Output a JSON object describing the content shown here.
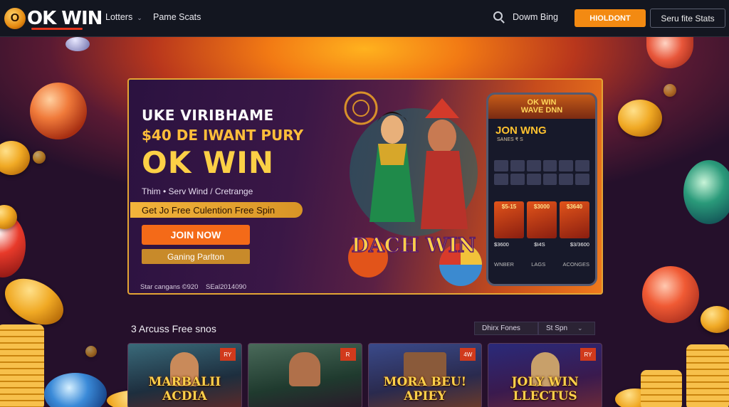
{
  "nav": {
    "logo_text": "OK WIN",
    "links": [
      "Lotters",
      "Pame Scats"
    ],
    "search_label": "Dowm Bing",
    "hold_button": "HIOLDONT",
    "stats_button": "Seru fite Stats"
  },
  "hero": {
    "title_line1": "UKE VIRIBHAME",
    "title_line2": "$40 DE IWANT PURY",
    "title_line3": "OK WIN",
    "subtitle": "Thim • Serv Wind / Cretrange",
    "promo": "Get Jo Free Culention Free Spin",
    "join_button": "JOIN NOW",
    "gaming_button": "Ganing Parlton",
    "footer_left": "Star cangans ©920",
    "footer_right": "SEal2014090",
    "art_caption": "DACH WIN",
    "phone": {
      "header": "OK WIN\nWAVE DNN",
      "title": "JON WNG",
      "subtitle": "SANES ₹ S",
      "tiles": [
        "$5-15",
        "$3000",
        "$3640"
      ],
      "values": [
        "$3600",
        "$I4S",
        "$3/3600"
      ],
      "bottom": [
        "WNBER",
        "LAGS",
        "ACONGES"
      ]
    }
  },
  "games": {
    "title": "3 Arcuss Free snos",
    "filter1": "Dhirx Fones",
    "filter2": "St Spn",
    "cards": [
      {
        "title": "MARBALII ACDIA",
        "badge": "RY"
      },
      {
        "title": "",
        "badge": "R"
      },
      {
        "title": "MORA BEU! APIEY",
        "badge": "4W"
      },
      {
        "title": "JOLY WIN LLECTUS",
        "badge": "RY"
      }
    ]
  },
  "colors": {
    "nav_bg": "#131620",
    "accent_orange": "#f38a12",
    "gold": "#fcd046",
    "join_orange": "#f46a18"
  }
}
